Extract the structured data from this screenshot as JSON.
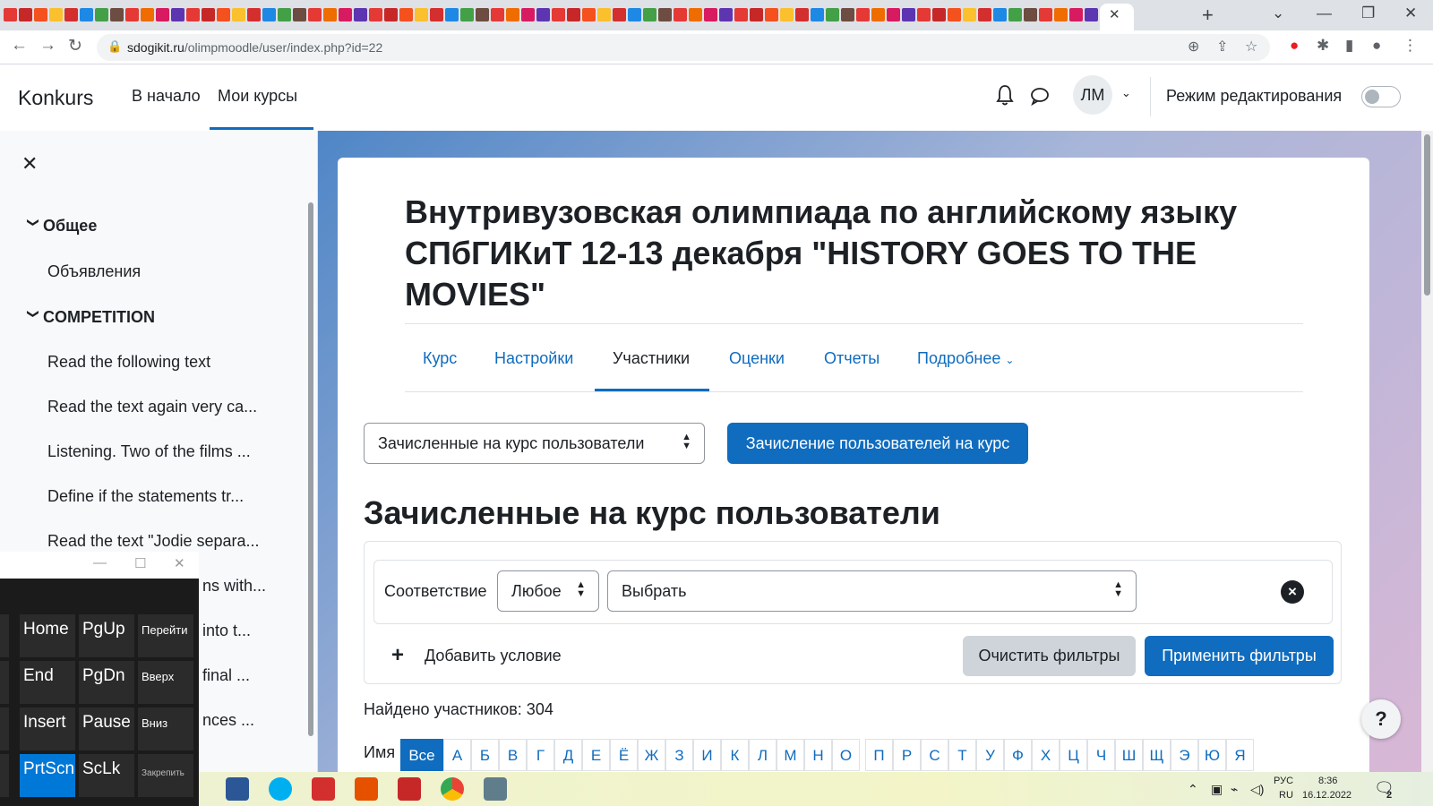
{
  "browser": {
    "active_tab_close": "✕",
    "new_tab": "+",
    "url_host": "sdogikit.ru",
    "url_path": "/olimpmoodle/user/index.php?id=22"
  },
  "navbar": {
    "brand": "Konkurs",
    "items": [
      {
        "label": "В начало"
      },
      {
        "label": "Мои курсы"
      }
    ],
    "avatar_initials": "ЛМ",
    "edit_mode_label": "Режим редактирования"
  },
  "drawer": {
    "sections": [
      {
        "title": "Общее",
        "items": [
          "Объявления"
        ]
      },
      {
        "title": "COMPETITION",
        "items": [
          "Read the following text",
          "Read the text again very ca...",
          "Listening. Two of the films ...",
          "Define if the statements tr...",
          "Read the text \"Jodie separa...",
          "ns with...",
          "into t...",
          "final ...",
          "nces ..."
        ]
      }
    ]
  },
  "course": {
    "title": "Внутривузовская олимпиада по английскому языку СПбГИКиТ 12-13 декабря \"HISTORY GOES TO THE MOVIES\"",
    "secondary_nav": [
      "Курс",
      "Настройки",
      "Участники",
      "Оценки",
      "Отчеты",
      "Подробнее"
    ],
    "secondary_nav_active": 2
  },
  "participants": {
    "select_value": "Зачисленные на курс пользователи",
    "enrol_button": "Зачисление пользователей на курс",
    "heading": "Зачисленные на курс пользователи",
    "filter": {
      "match_label": "Соответствие",
      "match_value": "Любое",
      "type_value": "Выбрать",
      "add_condition": "Добавить условие",
      "clear": "Очистить фильтры",
      "apply": "Применить фильтры"
    },
    "found": "Найдено участников: 304",
    "first_name_label": "Имя",
    "letters": [
      "Все",
      "А",
      "Б",
      "В",
      "Г",
      "Д",
      "Е",
      "Ё",
      "Ж",
      "З",
      "И",
      "К",
      "Л",
      "М",
      "Н",
      "О",
      "П",
      "Р",
      "С",
      "Т",
      "У",
      "Ф",
      "Х",
      "Ц",
      "Ч",
      "Ш",
      "Щ",
      "Э",
      "Ю",
      "Я"
    ]
  },
  "keyboard": {
    "rows": [
      [
        "Home",
        "PgUp",
        "Перейти"
      ],
      [
        "End",
        "PgDn",
        "Вверх"
      ],
      [
        "Insert",
        "Pause",
        "Вниз"
      ],
      [
        "PrtScn",
        "ScLk",
        "Закрепить"
      ]
    ]
  },
  "taskbar": {
    "lang_top": "РУС",
    "lang_bottom": "RU",
    "time": "8:36",
    "date": "16.12.2022",
    "notif_count": "2"
  },
  "colors": {
    "brand_blue": "#0f6cbf",
    "text": "#1d2125"
  }
}
